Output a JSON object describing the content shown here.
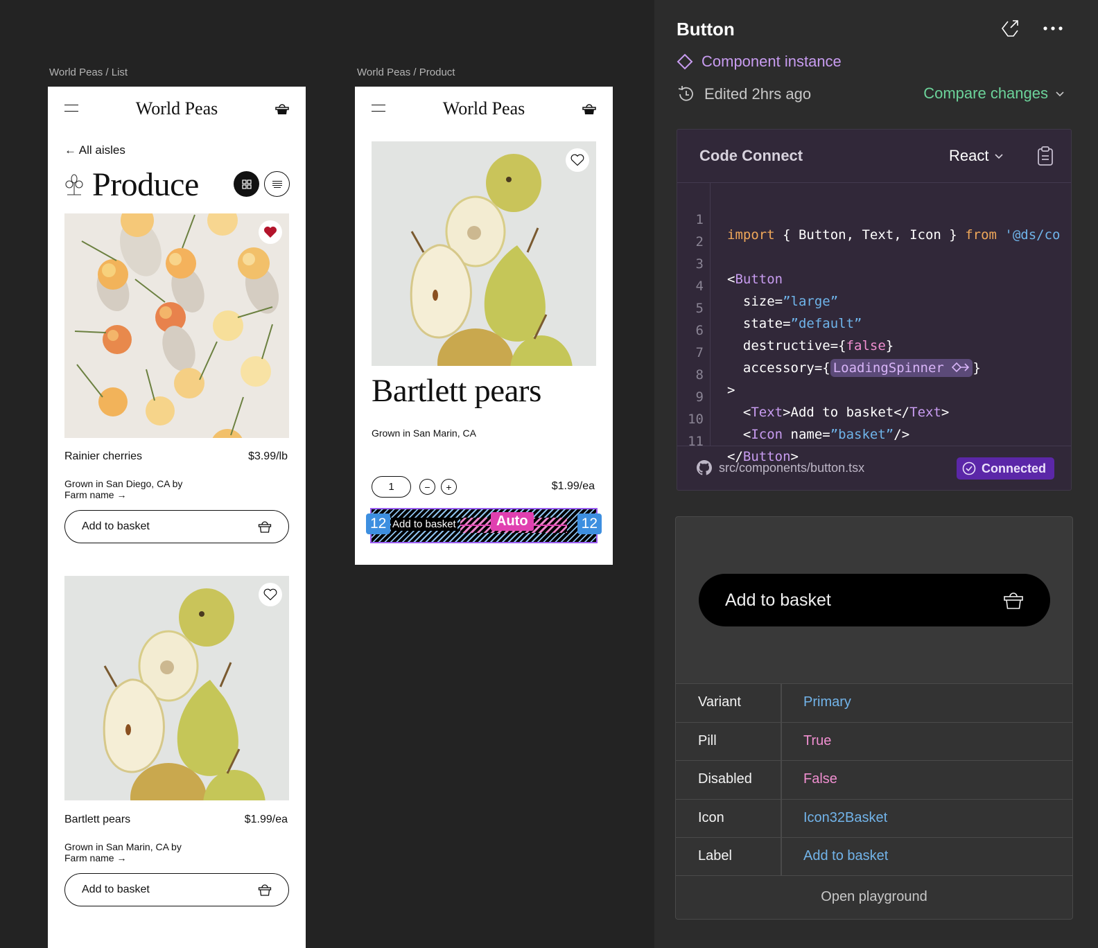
{
  "canvas": {
    "list_frame": {
      "frame_label": "World Peas / List",
      "brand": "World Peas",
      "back_link": "← All aisles",
      "page_title": "Produce",
      "products": [
        {
          "name": "Rainier cherries",
          "price": "$3.99/lb",
          "origin": "Grown in San Diego, CA by",
          "farm_link": "Farm name →",
          "button_label": "Add to basket",
          "favorited": true
        },
        {
          "name": "Bartlett pears",
          "price": "$1.99/ea",
          "origin": "Grown in San Marin, CA by",
          "farm_link": "Farm name →",
          "button_label": "Add to basket",
          "favorited": false
        }
      ]
    },
    "product_frame": {
      "frame_label": "World Peas / Product",
      "brand": "World Peas",
      "title": "Bartlett pears",
      "origin": "Grown in San Marin, CA",
      "quantity": "1",
      "price": "$1.99/ea",
      "button_label": "Add to basket",
      "favorited": false,
      "selection_overlay": {
        "padding_left": "12",
        "padding_right": "12",
        "gap": "Auto"
      }
    }
  },
  "inspector": {
    "title": "Button",
    "component_type": "Component instance",
    "edited": "Edited 2hrs ago",
    "compare_label": "Compare changes",
    "code_connect": {
      "title": "Code Connect",
      "language": "React",
      "lines": [
        {
          "n": "1"
        },
        {
          "n": "2"
        },
        {
          "n": "3"
        },
        {
          "n": "4"
        },
        {
          "n": "5"
        },
        {
          "n": "6"
        },
        {
          "n": "7"
        },
        {
          "n": "8"
        },
        {
          "n": "9"
        },
        {
          "n": "10"
        },
        {
          "n": "11"
        }
      ],
      "tokens": {
        "l1_import": "import",
        "l1_names": " { Button, Text, Icon } ",
        "l1_from": "from",
        "l1_path": " '@ds/co",
        "l3_open": "<",
        "l3_tag": "Button",
        "l4_attr": "  size=",
        "l4_val": "”large”",
        "l5_attr": "  state=",
        "l5_val": "”default”",
        "l6_attr": "  destructive={",
        "l6_val": "false",
        "l6_close": "}",
        "l7_attr": "  accessory={",
        "l7_chip": "LoadingSpinner",
        "l7_close": "}",
        "l8": ">",
        "l9_indent": "  <",
        "l9_tag": "Text",
        "l9_text": ">Add to basket</",
        "l9_tag2": "Text",
        "l9_end": ">",
        "l10_indent": "  <",
        "l10_tag": "Icon",
        "l10_attr": " name=",
        "l10_val": "”basket”",
        "l10_end": "/>",
        "l11_open": "</",
        "l11_tag": "Button",
        "l11_end": ">"
      },
      "file_path": "src/components/button.tsx",
      "status": "Connected"
    },
    "preview": {
      "button_label": "Add to basket"
    },
    "properties": [
      {
        "key": "Variant",
        "value": "Primary",
        "kind": "blue"
      },
      {
        "key": "Pill",
        "value": "True",
        "kind": "pink"
      },
      {
        "key": "Disabled",
        "value": "False",
        "kind": "pink"
      },
      {
        "key": "Icon",
        "value": "Icon32Basket",
        "kind": "blue"
      },
      {
        "key": "Label",
        "value": "Add to basket",
        "kind": "blue"
      }
    ],
    "playground_label": "Open playground"
  },
  "colors": {
    "canvas_bg": "#232323",
    "panel_bg": "#2c2c2c",
    "code_bg": "#312839",
    "accent_purple": "#c89cf0",
    "accent_green": "#6cd39a",
    "connected_bg": "#5b27a8",
    "value_blue": "#72b4ea",
    "value_pink": "#f08fd0",
    "favorite_red": "#b3142b"
  }
}
